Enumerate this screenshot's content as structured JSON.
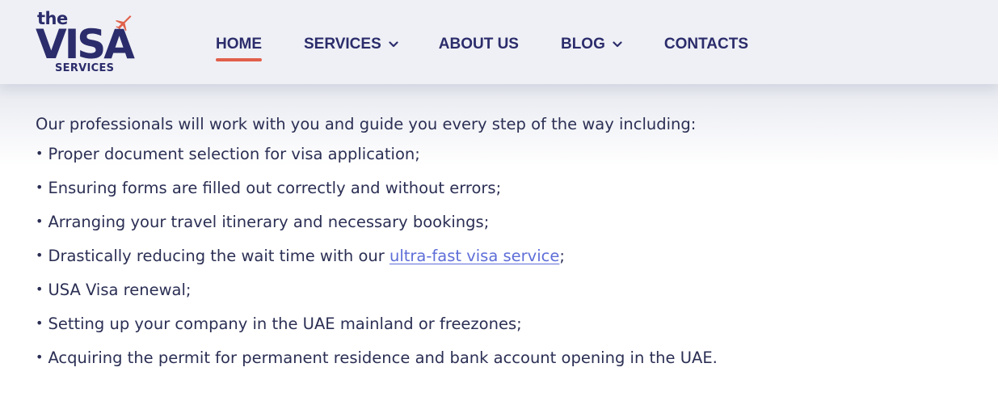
{
  "logo": {
    "the": "the",
    "visa": "VISA",
    "services": "SERVICES",
    "accent_color": "#e0604a",
    "brand_color": "#2b2c6b",
    "icon": "plane-icon"
  },
  "nav": {
    "home": "HOME",
    "services": "SERVICES",
    "about": "ABOUT US",
    "blog": "BLOG",
    "contacts": "CONTACTS",
    "active": "HOME",
    "dropdown_icon": "chevron-down-icon"
  },
  "content": {
    "intro": "Our professionals will work with you and guide you every step of the way including:",
    "bullet": "•",
    "items": [
      "Proper document selection for visa application;",
      "Ensuring forms are filled out correctly and without errors;",
      "Arranging your travel itinerary and necessary bookings;",
      "Drastically reducing the wait time with our",
      "USA Visa renewal;",
      "Setting up your company in the UAE mainland or freezones;",
      "Acquiring the permit for permanent residence and bank account opening in the UAE."
    ],
    "link_text": "ultra-fast visa service",
    "link_suffix": ";",
    "link_color": "#5e6ed8"
  }
}
